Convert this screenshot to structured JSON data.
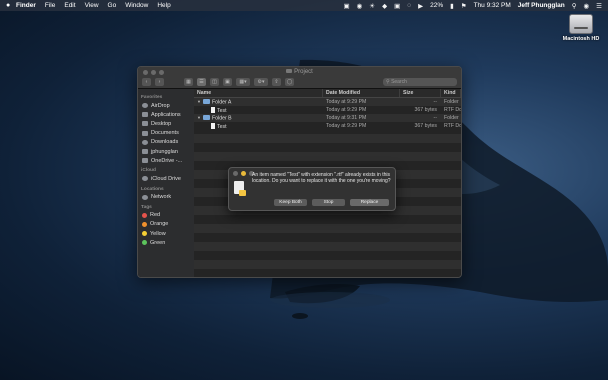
{
  "menubar": {
    "app_name": "Finder",
    "items": [
      "File",
      "Edit",
      "View",
      "Go",
      "Window",
      "Help"
    ],
    "battery": "22%",
    "clock": "Thu 9:32 PM",
    "user": "Jeff Phungglan"
  },
  "desktop": {
    "hd_label": "Macintosh HD"
  },
  "finder": {
    "title": "Project",
    "search_placeholder": "Search",
    "sidebar": {
      "favorites_heading": "Favorites",
      "favorites": [
        "AirDrop",
        "Applications",
        "Desktop",
        "Documents",
        "Downloads",
        "jphungglan",
        "OneDrive -..."
      ],
      "icloud_heading": "iCloud",
      "icloud": [
        "iCloud Drive"
      ],
      "locations_heading": "Locations",
      "locations": [
        "Network"
      ],
      "tags_heading": "Tags",
      "tags": [
        {
          "label": "Red",
          "color": "#e5534b"
        },
        {
          "label": "Orange",
          "color": "#f0912d"
        },
        {
          "label": "Yellow",
          "color": "#f5cf34"
        },
        {
          "label": "Green",
          "color": "#5cc45c"
        }
      ]
    },
    "columns": {
      "name": "Name",
      "date": "Date Modified",
      "size": "Size",
      "kind": "Kind"
    },
    "rows": [
      {
        "name": "Folder A",
        "date": "Today at 9:29 PM",
        "size": "--",
        "kind": "Folder",
        "type": "folder"
      },
      {
        "name": "Test",
        "date": "Today at 9:29 PM",
        "size": "367 bytes",
        "kind": "RTF Doc",
        "type": "file"
      },
      {
        "name": "Folder B",
        "date": "Today at 9:31 PM",
        "size": "--",
        "kind": "Folder",
        "type": "folder"
      },
      {
        "name": "Test",
        "date": "Today at 9:29 PM",
        "size": "367 bytes",
        "kind": "RTF Doc",
        "type": "file"
      }
    ]
  },
  "dialog": {
    "message": "An item named \"Test\" with extension \".rtf\" already exists in this location. Do you want to replace it with the one you're moving?",
    "keep_both": "Keep Both",
    "stop": "Stop",
    "replace": "Replace"
  }
}
